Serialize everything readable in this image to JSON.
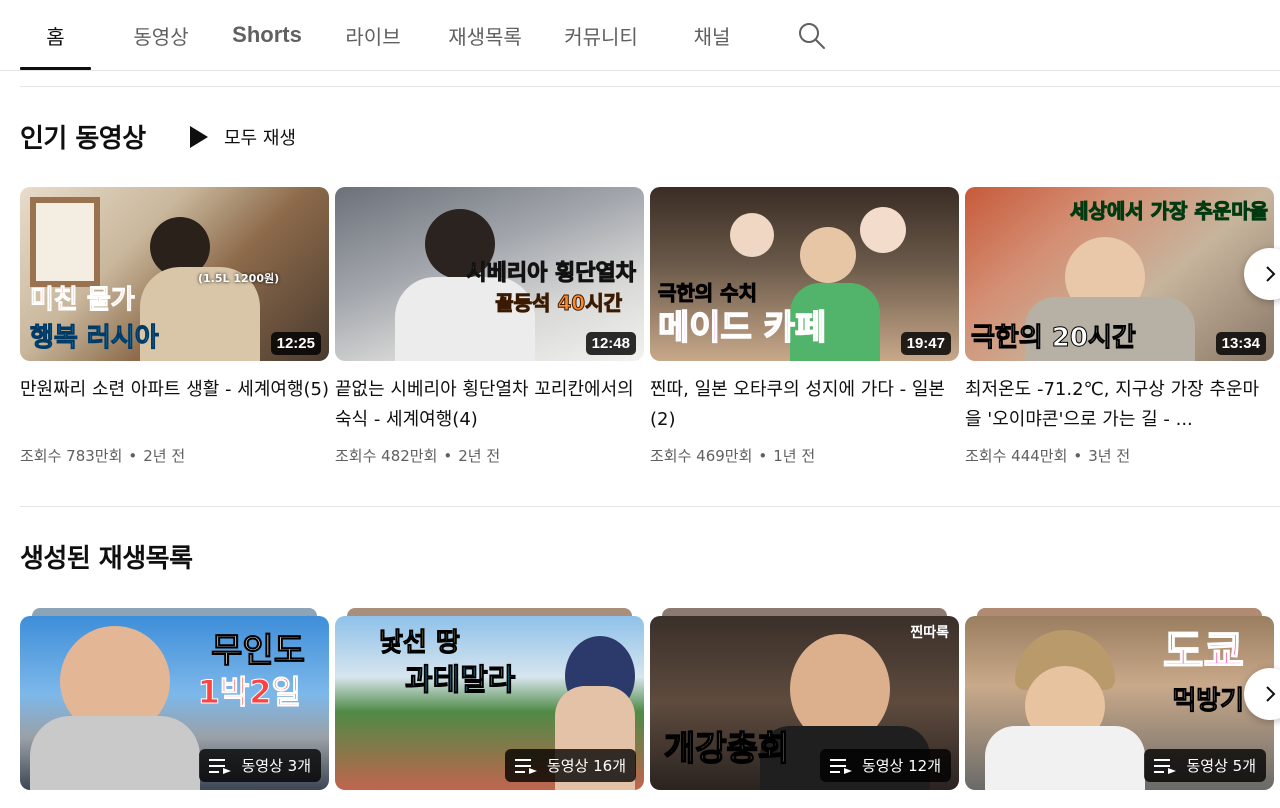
{
  "tabs": [
    {
      "label": "홈",
      "active": true
    },
    {
      "label": "동영상"
    },
    {
      "label": "Shorts"
    },
    {
      "label": "라이브"
    },
    {
      "label": "재생목록"
    },
    {
      "label": "커뮤니티"
    },
    {
      "label": "채널"
    }
  ],
  "search": {
    "icon": "search-icon"
  },
  "popular": {
    "title": "인기 동영상",
    "play_all": "모두 재생",
    "videos": [
      {
        "title": "만원짜리 소련 아파트 생활 - 세계여행(5)",
        "views": "조회수 783만회",
        "age": "2년 전",
        "duration": "12:25",
        "thumb_text": [
          "미친 물가",
          "행복 러시아",
          "(1.5L 1200원)"
        ]
      },
      {
        "title": "끝없는 시베리아 횡단열차 꼬리칸에서의 숙식 - 세계여행(4)",
        "views": "조회수 482만회",
        "age": "2년 전",
        "duration": "12:48",
        "thumb_text": [
          "시베리아 횡단열차",
          "꼴등석 40시간"
        ]
      },
      {
        "title": "찐따, 일본 오타쿠의 성지에 가다 - 일본(2)",
        "views": "조회수 469만회",
        "age": "1년 전",
        "duration": "19:47",
        "thumb_text": [
          "극한의 수치",
          "메이드 카페"
        ]
      },
      {
        "title": "최저온도 -71.2℃, 지구상 가장 추운마을 '오이먀콘'으로 가는 길 - ...",
        "views": "조회수 444만회",
        "age": "3년 전",
        "duration": "13:34",
        "thumb_text": [
          "세상에서 가장 추운마을",
          "극한의 20시간"
        ]
      }
    ]
  },
  "playlists": {
    "title": "생성된 재생목록",
    "items": [
      {
        "count": "동영상 3개",
        "thumb_text": [
          "무인도",
          "1박2일"
        ]
      },
      {
        "count": "동영상 16개",
        "thumb_text": [
          "낯선 땅",
          "과테말라"
        ]
      },
      {
        "count": "동영상 12개",
        "thumb_text": [
          "개강총회",
          "찐따록"
        ]
      },
      {
        "count": "동영상 5개",
        "thumb_text": [
          "도쿄",
          "먹방기행"
        ]
      }
    ]
  }
}
